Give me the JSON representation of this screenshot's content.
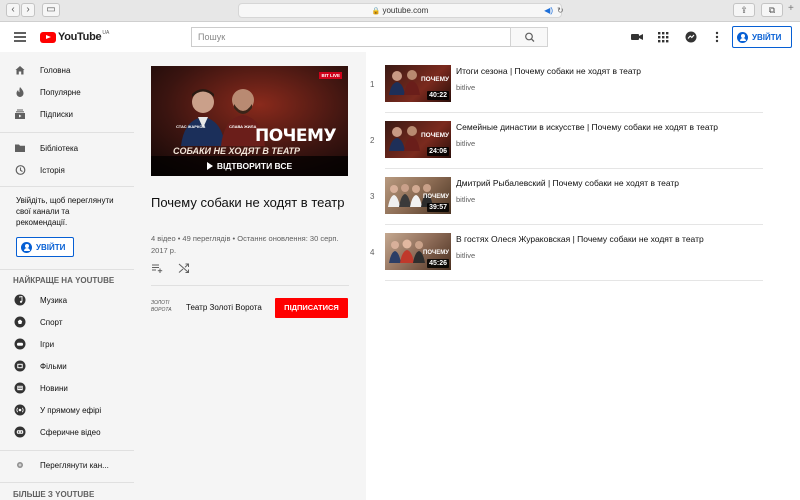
{
  "browser": {
    "url": "youtube.com"
  },
  "masthead": {
    "logo_text": "YouTube",
    "region": "UA",
    "search_placeholder": "Пошук",
    "signin_label": "УВІЙТИ"
  },
  "sidebar": {
    "main_items": [
      {
        "label": "Головна",
        "icon": "home-icon"
      },
      {
        "label": "Популярне",
        "icon": "flame-icon"
      },
      {
        "label": "Підписки",
        "icon": "subscriptions-icon"
      }
    ],
    "library_items": [
      {
        "label": "Бібліотека",
        "icon": "folder-icon"
      },
      {
        "label": "Історія",
        "icon": "history-icon"
      }
    ],
    "signin_prompt": "Увійдіть, щоб переглянути свої канали та рекомендації.",
    "signin_label": "УВІЙТИ",
    "best_heading": "НАЙКРАЩЕ НА YOUTUBE",
    "best_items": [
      {
        "label": "Музика",
        "icon": "music-icon"
      },
      {
        "label": "Спорт",
        "icon": "sport-icon"
      },
      {
        "label": "Ігри",
        "icon": "gaming-icon"
      },
      {
        "label": "Фільми",
        "icon": "movies-icon"
      },
      {
        "label": "Новини",
        "icon": "news-icon"
      },
      {
        "label": "У прямому ефірі",
        "icon": "live-icon"
      },
      {
        "label": "Сферичне відео",
        "icon": "vr-icon"
      }
    ],
    "browse_channels": "Переглянути кан...",
    "more_heading": "БІЛЬШЕ З YOUTUBE"
  },
  "playlist": {
    "thumb": {
      "badge": "BIT LIVE",
      "person1": "СТАС ЖАРКОВ",
      "person2": "СЛАВА ЖИЛА",
      "big_line1": "ПОЧЕМУ",
      "big_line2": "СОБАКИ НЕ ХОДЯТ В ТЕАТР",
      "play_all": "ВІДТВОРИТИ ВСЕ"
    },
    "title": "Почему собаки не ходят в театр",
    "stats": "4 відео • 49 переглядів • Останнє оновлення: 30 серп. 2017 р.",
    "owner_logo_text": "ЗОЛОТІ ВОРОТА",
    "owner_name": "Театр Золоті Ворота",
    "subscribe_label": "ПІДПИСАТИСЯ"
  },
  "videos": [
    {
      "index": "1",
      "title": "Итоги сезона | Почему собаки не ходят в театр",
      "channel": "bitlive",
      "duration": "40:22",
      "thumb_text": "ПОЧЕМУ"
    },
    {
      "index": "2",
      "title": "Семейные династии в искусстве | Почему собаки не ходят в театр",
      "channel": "bitlive",
      "duration": "24:06",
      "thumb_text": "ПОЧЕМУ"
    },
    {
      "index": "3",
      "title": "Дмитрий Рыбалевский | Почему собаки не ходят в театр",
      "channel": "bitlive",
      "duration": "39:57",
      "thumb_text": "ПОЧЕМУ"
    },
    {
      "index": "4",
      "title": "В гостях Олеся Жураковская | Почему собаки не ходят в театр",
      "channel": "bitlive",
      "duration": "45:26",
      "thumb_text": "ПОЧЕМУ"
    }
  ],
  "colors": {
    "accent_blue": "#065fd4",
    "subscribe_red": "#ff0000",
    "sidebar_bg": "#f5f5f5"
  }
}
